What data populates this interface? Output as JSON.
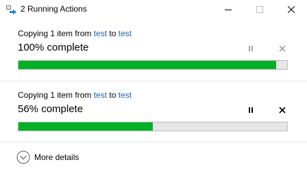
{
  "window": {
    "title": "2 Running Actions",
    "icon": "file-copy-icon",
    "controls": [
      "minimize-icon",
      "maximize-icon",
      "close-icon"
    ]
  },
  "operations": [
    {
      "desc_prefix": "Copying 1 item from",
      "from": "test",
      "to_word": "to",
      "to": "test",
      "status": "100% complete",
      "progress": 0.96,
      "paused_enabled": false,
      "cancel_enabled": false
    },
    {
      "desc_prefix": "Copying 1 item from",
      "from": "test",
      "to_word": "to",
      "to": "test",
      "status": "56% complete",
      "progress": 0.5,
      "paused_enabled": true,
      "cancel_enabled": true
    }
  ],
  "footer": {
    "details_label": "More details",
    "icon": "chevron-down-circle-icon"
  },
  "colors": {
    "progress_fill": "#06b025",
    "progress_track": "#e6e6e6",
    "link": "#1f5fa8",
    "disabled_control": "#a0a0a0",
    "enabled_control": "#000000"
  }
}
